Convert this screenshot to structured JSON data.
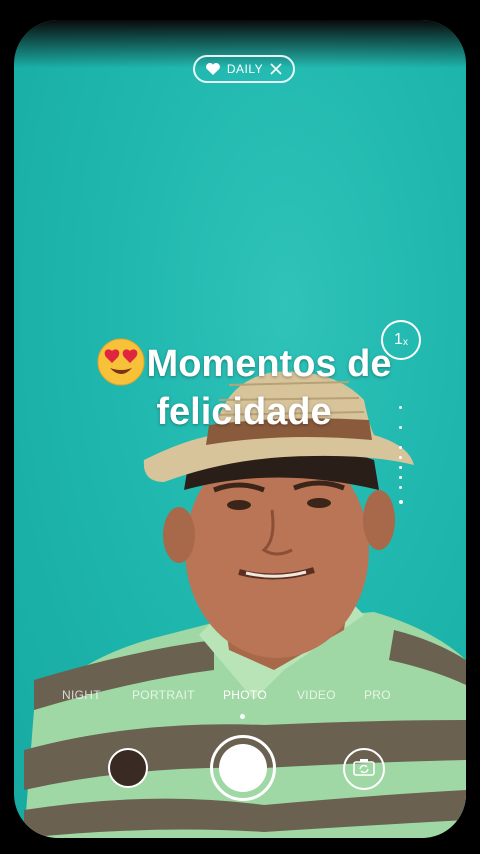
{
  "top_bar": {
    "daily_label": "DAILY",
    "icons": [
      "heart-icon",
      "close-icon"
    ]
  },
  "caption": {
    "emoji": "heart-eyes-emoji",
    "text": "Momentos de felicidade"
  },
  "zoom": {
    "value": "1",
    "unit": "x"
  },
  "modes": [
    {
      "label": "NIGHT",
      "active": false
    },
    {
      "label": "PORTRAIT",
      "active": false
    },
    {
      "label": "PHOTO",
      "active": true
    },
    {
      "label": "VIDEO",
      "active": false
    },
    {
      "label": "PRO",
      "active": false
    }
  ],
  "controls": {
    "icons": [
      "gallery-thumbnail",
      "shutter-icon",
      "camera-flip-icon"
    ]
  },
  "colors": {
    "background": "#1fb7ae",
    "accent": "#ffffff"
  }
}
